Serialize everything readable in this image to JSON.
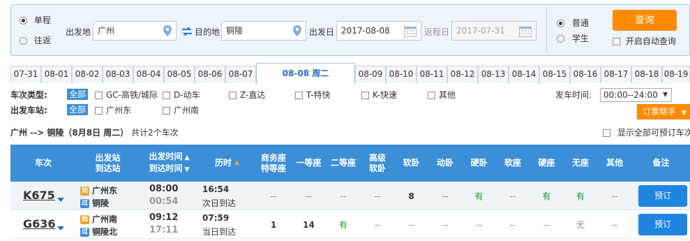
{
  "search": {
    "trip_one_way": "单程",
    "trip_round": "往返",
    "from_label": "出发地",
    "from_value": "广州",
    "to_label": "目的地",
    "to_value": "铜陵",
    "depart_label": "出发日",
    "depart_value": "2017-08-08",
    "return_label": "返程日",
    "return_value": "2017-07-31",
    "type_normal": "普通",
    "type_student": "学生",
    "query_button": "查询",
    "auto_query": "开启自动查询"
  },
  "date_tabs": [
    "07-31",
    "08-01",
    "08-02",
    "08-03",
    "08-04",
    "08-05",
    "08-06",
    "08-07",
    "08-08 周二",
    "08-09",
    "08-10",
    "08-11",
    "08-12",
    "08-13",
    "08-14",
    "08-15",
    "08-16",
    "08-17",
    "08-18",
    "08-19"
  ],
  "filters": {
    "train_type_label": "车次类型:",
    "all": "全部",
    "types": [
      "GC-高铁/城际",
      "D-动车",
      "Z-直达",
      "T-特快",
      "K-快速",
      "其他"
    ],
    "station_label": "出发车站:",
    "stations": [
      "广州东",
      "广州南"
    ],
    "depart_time_label": "发车时间:",
    "depart_time_value": "00:00--24:00",
    "booking_helper": "订票帮手"
  },
  "route_summary": {
    "route": "广州 --> 铜陵（8月8日  周二）",
    "count": "共计2个车次"
  },
  "show_all_bookable": "显示全部可预订车次",
  "table": {
    "headers": {
      "train": "车次",
      "station_1": "出发站",
      "station_2": "到达站",
      "time_1": "出发时间",
      "time_2": "到达时间",
      "duration": "历时",
      "business_1": "商务座",
      "business_2": "特等座",
      "first": "一等座",
      "second": "二等座",
      "premium_1": "高级",
      "premium_2": "软卧",
      "soft_sleeper": "软卧",
      "moving_sleeper": "动卧",
      "hard_sleeper": "硬卧",
      "soft_seat": "软座",
      "hard_seat": "硬座",
      "no_seat": "无座",
      "other": "其他",
      "remark": "备注"
    },
    "rows": [
      {
        "train_no": "K675",
        "from_badge": "始",
        "from_station": "广州东",
        "to_badge": "过",
        "to_station": "铜陵",
        "depart": "08:00",
        "arrive": "00:54",
        "duration": "16:54",
        "arrival_day": "次日到达",
        "seats": [
          "--",
          "--",
          "--",
          "--",
          "8",
          "--",
          "有",
          "--",
          "有",
          "有",
          "--"
        ],
        "book": "预订"
      },
      {
        "train_no": "G636",
        "from_badge": "始",
        "from_station": "广州南",
        "to_badge": "过",
        "to_station": "铜陵北",
        "depart": "09:12",
        "arrive": "17:11",
        "duration": "07:59",
        "arrival_day": "当日到达",
        "seats": [
          "1",
          "14",
          "有",
          "--",
          "--",
          "--",
          "--",
          "--",
          "--",
          "无",
          "--"
        ],
        "book": "预订"
      }
    ]
  }
}
